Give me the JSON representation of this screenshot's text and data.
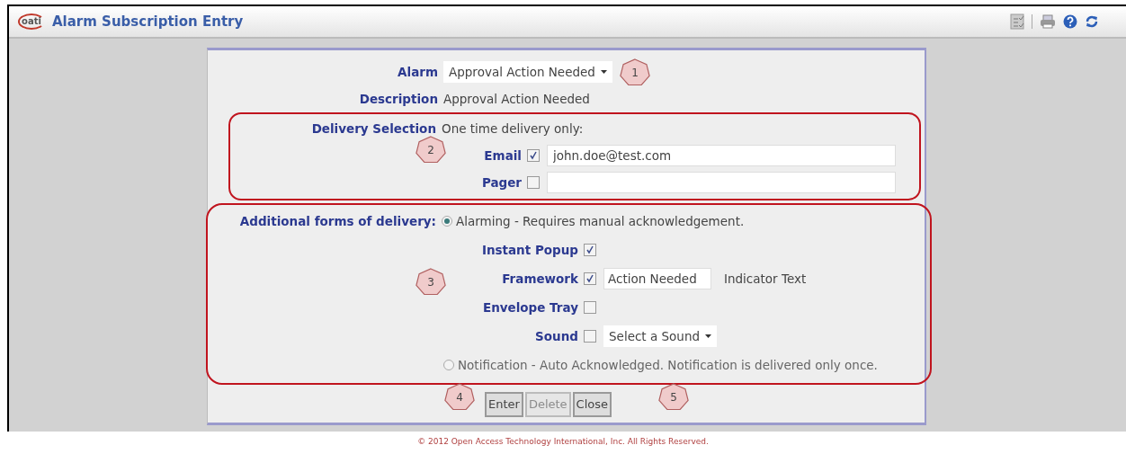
{
  "window": {
    "logo": "oati",
    "title": "Alarm Subscription Entry"
  },
  "form": {
    "alarm": {
      "label": "Alarm",
      "value": "Approval Action Needed"
    },
    "description": {
      "label": "Description",
      "value": "Approval Action Needed"
    },
    "delivery_selection": {
      "label": "Delivery Selection",
      "note": "One time delivery only:",
      "channels": [
        {
          "label": "Email",
          "checked": true,
          "value": "john.doe@test.com"
        },
        {
          "label": "Pager",
          "checked": false
        }
      ]
    },
    "additional": {
      "label": "Additional forms of delivery:",
      "options": [
        {
          "label": "Alarming - Requires manual acknowledgement.",
          "selected": true,
          "settings": [
            {
              "kind": "checkbox",
              "label": "Instant Popup",
              "checked": true
            },
            {
              "kind": "text",
              "label": "Framework",
              "checked": true,
              "value": "Action Needed",
              "suffix": "Indicator Text"
            },
            {
              "kind": "checkbox",
              "label": "Envelope Tray",
              "checked": false
            },
            {
              "kind": "select",
              "label": "Sound",
              "checked": false,
              "value": "Select a Sound"
            }
          ]
        },
        {
          "label": "Notification - Auto Acknowledged. Notification is delivered only once.",
          "selected": false
        }
      ]
    },
    "buttons": [
      {
        "label": "Enter",
        "disabled": false
      },
      {
        "label": "Delete",
        "disabled": true
      },
      {
        "label": "Close",
        "disabled": false
      }
    ]
  },
  "callouts": [
    "1",
    "2",
    "3",
    "4",
    "5"
  ],
  "footer": "© 2012 Open Access Technology International, Inc. All Rights Reserved."
}
